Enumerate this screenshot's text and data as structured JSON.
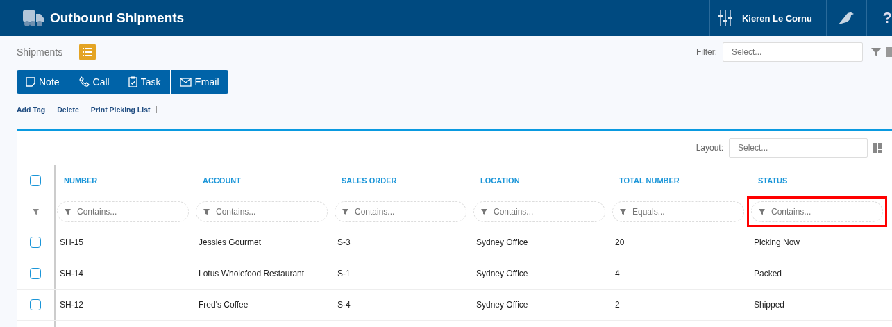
{
  "header": {
    "title": "Outbound Shipments",
    "user": "Kieren Le Cornu",
    "help": "?"
  },
  "toolbar": {
    "section": "Shipments",
    "filter_label": "Filter:",
    "filter_placeholder": "Select...",
    "actions": [
      "Note",
      "Call",
      "Task",
      "Email"
    ],
    "links": [
      "Add Tag",
      "Delete",
      "Print Picking List"
    ]
  },
  "table": {
    "layout_label": "Layout:",
    "layout_placeholder": "Select...",
    "all_checked": false,
    "columns": [
      {
        "label": "NUMBER",
        "placeholder": "Contains...",
        "highlighted": false
      },
      {
        "label": "ACCOUNT",
        "placeholder": "Contains...",
        "highlighted": false
      },
      {
        "label": "SALES ORDER",
        "placeholder": "Contains...",
        "highlighted": false
      },
      {
        "label": "LOCATION",
        "placeholder": "Contains...",
        "highlighted": false
      },
      {
        "label": "TOTAL NUMBER",
        "placeholder": "Equals...",
        "highlighted": false
      },
      {
        "label": "STATUS",
        "placeholder": "Contains...",
        "highlighted": true
      }
    ],
    "rows": [
      {
        "checked": false,
        "cells": [
          "SH-15",
          "Jessies Gourmet",
          "S-3",
          "Sydney Office",
          "20",
          "Picking Now"
        ]
      },
      {
        "checked": false,
        "cells": [
          "SH-14",
          "Lotus Wholefood Restaurant",
          "S-1",
          "Sydney Office",
          "4",
          "Packed"
        ]
      },
      {
        "checked": false,
        "cells": [
          "SH-12",
          "Fred's Coffee",
          "S-4",
          "Sydney Office",
          "2",
          "Shipped"
        ]
      }
    ]
  }
}
